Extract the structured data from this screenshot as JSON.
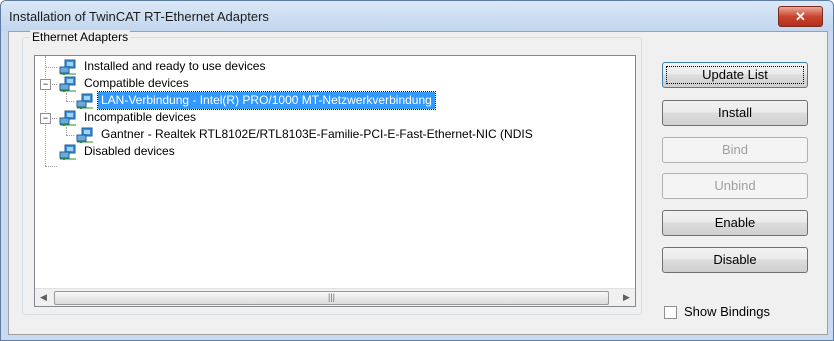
{
  "window": {
    "title": "Installation of TwinCAT RT-Ethernet Adapters",
    "close_glyph": "✕"
  },
  "group": {
    "label": "Ethernet Adapters"
  },
  "tree": [
    {
      "label": "Installed and ready to use devices",
      "icon": "network-adapter-icon",
      "expanded": null,
      "selected": false
    },
    {
      "label": "Compatible devices",
      "icon": "network-adapter-icon",
      "expanded": true,
      "selected": false
    },
    {
      "label": "LAN-Verbindung - Intel(R) PRO/1000 MT-Netzwerkverbindung",
      "icon": "network-adapter-icon",
      "expanded": null,
      "selected": true
    },
    {
      "label": "Incompatible devices",
      "icon": "network-adapter-icon",
      "expanded": true,
      "selected": false
    },
    {
      "label": "Gantner - Realtek RTL8102E/RTL8103E-Familie-PCI-E-Fast-Ethernet-NIC (NDIS",
      "icon": "network-adapter-icon",
      "expanded": null,
      "selected": false
    },
    {
      "label": "Disabled devices",
      "icon": "network-adapter-icon",
      "expanded": null,
      "selected": false
    }
  ],
  "buttons": {
    "update_list": "Update List",
    "install": "Install",
    "bind": "Bind",
    "unbind": "Unbind",
    "enable": "Enable",
    "disable": "Disable"
  },
  "show_bindings": {
    "label": "Show Bindings",
    "checked": false
  },
  "colors": {
    "selection": "#3399ff",
    "title_bar": "#c9daf0",
    "close": "#c8452f"
  }
}
